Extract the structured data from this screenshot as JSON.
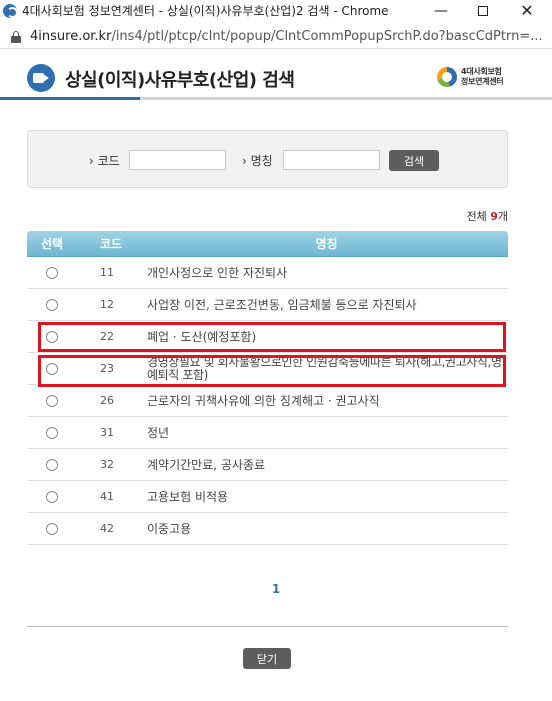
{
  "window": {
    "title": "4대사회보험 정보연계센터 - 상실(이직)사유부호(산업)2 검색 - Chrome",
    "url_host": "4insure.or.kr",
    "url_path": "/ins4/ptl/ptcp/clnt/popup/ClntCommPopupSrchP.do?bascCdPtrn=..."
  },
  "header": {
    "title": "상실(이직)사유부호(산업) 검색",
    "brand_line1": "4대사회보험",
    "brand_line2": "정보연계센터"
  },
  "search": {
    "code_label": "› 코드",
    "code_value": "",
    "name_label": "› 명칭",
    "name_value": "",
    "button_label": "검색"
  },
  "total": {
    "prefix": "전체",
    "count": "9",
    "suffix": "개"
  },
  "table": {
    "headers": [
      "선택",
      "코드",
      "명칭"
    ],
    "rows": [
      {
        "code": "11",
        "name": "개인사정으로 인한 자진퇴사"
      },
      {
        "code": "12",
        "name": "사업장 이전, 근로조건변동, 임금체불 등으로 자진퇴사"
      },
      {
        "code": "22",
        "name": "폐업 · 도산(예정포함)"
      },
      {
        "code": "23",
        "name": "경영상필요 및 회사불황으로인한 인원감축등에따른 퇴사(해고,권고사직,명예퇴직 포함)"
      },
      {
        "code": "26",
        "name": "근로자의 귀책사유에 의한 징계해고 · 권고사직"
      },
      {
        "code": "31",
        "name": "정년"
      },
      {
        "code": "32",
        "name": "계약기간만료, 공사종료"
      },
      {
        "code": "41",
        "name": "고용보험 비적용"
      },
      {
        "code": "42",
        "name": "이중고용"
      }
    ]
  },
  "pagination": {
    "current": "1"
  },
  "footer": {
    "close_label": "닫기"
  },
  "colors": {
    "accent": "#2f6fb0",
    "table_header": "#7fc1da",
    "highlight": "#e0141e",
    "button": "#5d5d5d"
  }
}
